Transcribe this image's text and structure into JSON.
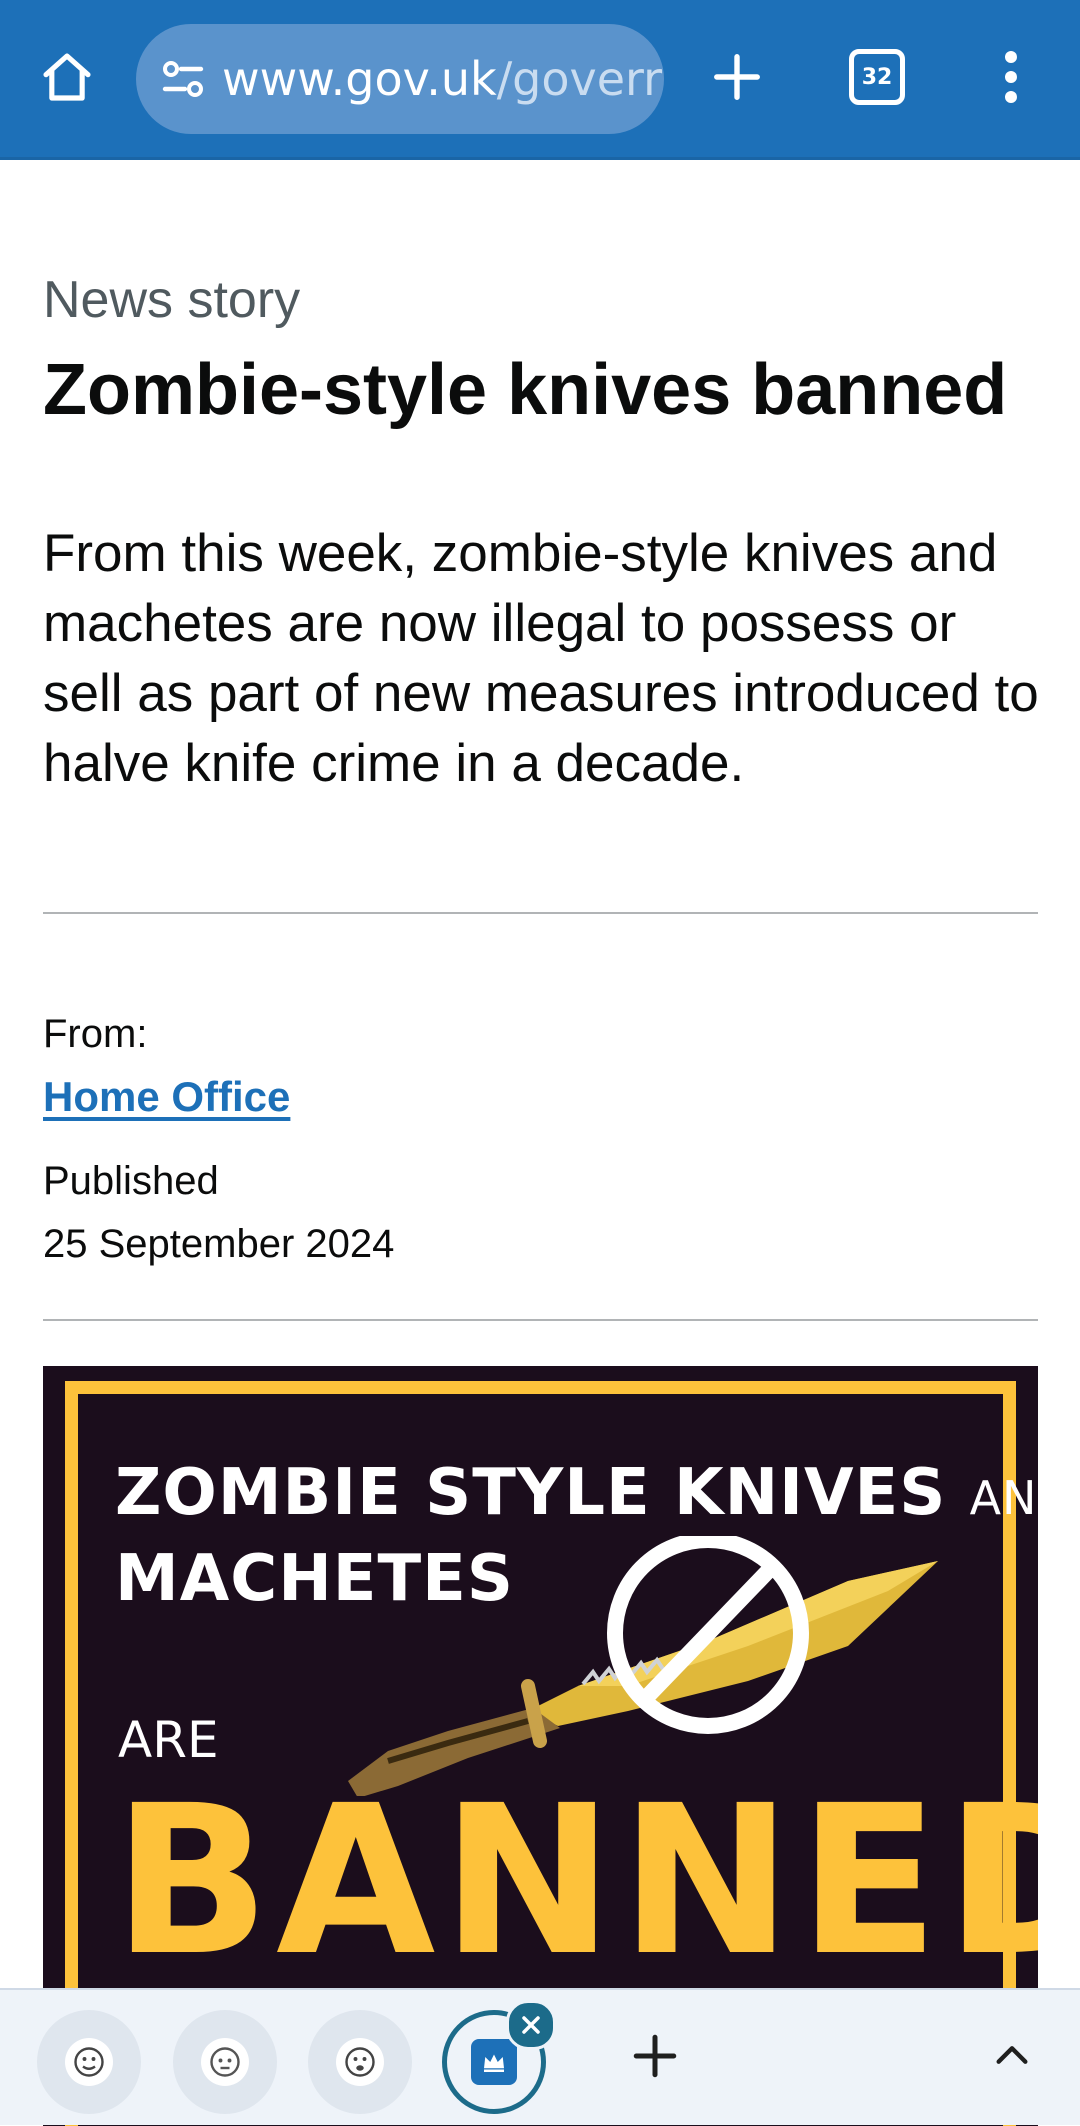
{
  "browser": {
    "url_host": "www.gov.uk",
    "url_path": "/goverr",
    "tab_count": "32",
    "toolbar_color": "#1d70b8"
  },
  "article": {
    "caption": "News story",
    "title": "Zombie-style knives banned",
    "lead": "From this week, zombie-style knives and machetes are now illegal to possess or sell as part of new measures introduced to halve knife crime in a decade.",
    "from_label": "From:",
    "from_link": "Home Office",
    "published_label": "Published",
    "published_date": "25 September 2024",
    "link_color": "#1d70b8"
  },
  "banner": {
    "line1": "ZOMBIE STYLE KNIVES",
    "line1_and": "AND",
    "line2": "MACHETES",
    "are": "ARE",
    "banned": "BANNED",
    "accent_color": "#fdc23b",
    "background_color": "#1b0d1c"
  },
  "tab_strip": {
    "tabs": [
      {
        "icon": "face-icon"
      },
      {
        "icon": "face-icon"
      },
      {
        "icon": "face-icon"
      },
      {
        "icon": "crown-icon",
        "active": true
      }
    ]
  }
}
